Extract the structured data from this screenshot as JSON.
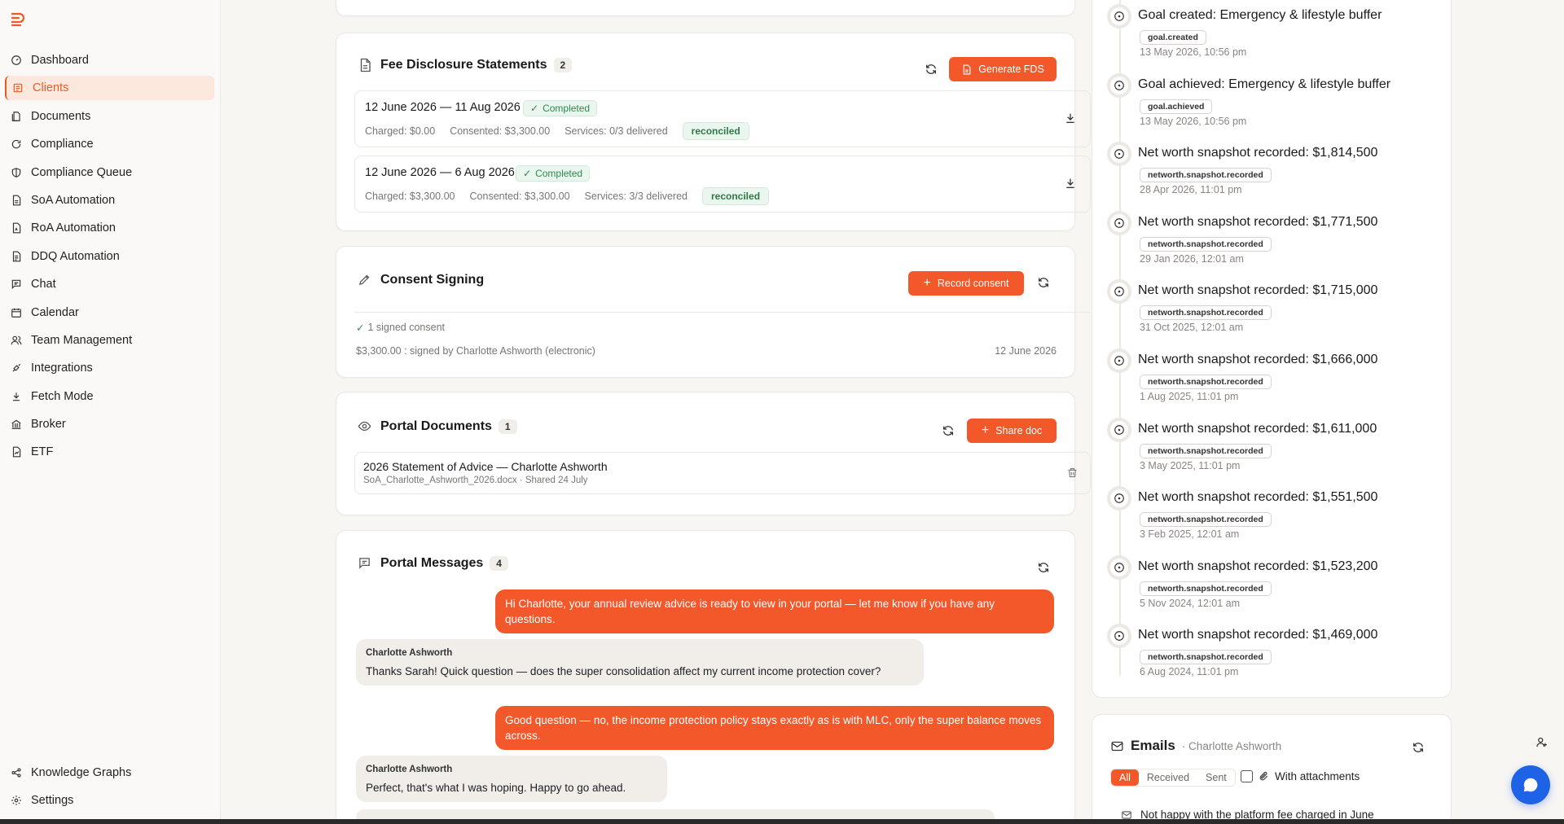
{
  "sidebar": {
    "items": [
      {
        "label": "Dashboard",
        "icon": "dashboard-icon"
      },
      {
        "label": "Clients",
        "icon": "clients-icon",
        "active": true
      },
      {
        "label": "Documents",
        "icon": "documents-icon"
      },
      {
        "label": "Compliance",
        "icon": "compliance-icon"
      },
      {
        "label": "Compliance Queue",
        "icon": "compliance-queue-icon"
      },
      {
        "label": "SoA Automation",
        "icon": "soa-automation-icon"
      },
      {
        "label": "RoA Automation",
        "icon": "roa-automation-icon"
      },
      {
        "label": "DDQ Automation",
        "icon": "ddq-automation-icon"
      },
      {
        "label": "Chat",
        "icon": "chat-icon"
      },
      {
        "label": "Calendar",
        "icon": "calendar-icon"
      },
      {
        "label": "Team Management",
        "icon": "team-icon"
      },
      {
        "label": "Integrations",
        "icon": "integrations-icon"
      },
      {
        "label": "Fetch Mode",
        "icon": "fetch-icon"
      },
      {
        "label": "Broker",
        "icon": "broker-icon"
      },
      {
        "label": "ETF",
        "icon": "etf-icon"
      }
    ],
    "bottom": [
      {
        "label": "Knowledge Graphs",
        "icon": "knowledge-graph-icon"
      },
      {
        "label": "Settings",
        "icon": "settings-icon"
      }
    ]
  },
  "fds": {
    "title": "Fee Disclosure Statements",
    "count": "2",
    "generate_label": "Generate FDS",
    "rows": [
      {
        "period": "12 June 2026 — 11 Aug 2026",
        "status": "Completed",
        "charged": "Charged: $0.00",
        "consented": "Consented: $3,300.00",
        "services": "Services: 0/3 delivered",
        "tag": "reconciled"
      },
      {
        "period": "12 June 2026 — 6 Aug 2026",
        "status": "Completed",
        "charged": "Charged: $3,300.00",
        "consented": "Consented: $3,300.00",
        "services": "Services: 3/3 delivered",
        "tag": "reconciled"
      }
    ]
  },
  "consent": {
    "title": "Consent Signing",
    "record_label": "Record consent",
    "signed_count": "1 signed consent",
    "detail": "$3,300.00 : signed by Charlotte Ashworth (electronic)",
    "date": "12 June 2026"
  },
  "portal_docs": {
    "title": "Portal Documents",
    "count": "1",
    "share_label": "Share doc",
    "doc_title": "2026 Statement of Advice — Charlotte Ashworth",
    "doc_meta": "SoA_Charlotte_Ashworth_2026.docx · Shared 24 July"
  },
  "portal_messages": {
    "title": "Portal Messages",
    "count": "4",
    "messages": [
      {
        "dir": "out",
        "text": "Hi Charlotte, your annual review advice is ready to view in your portal — let me know if you have any questions."
      },
      {
        "dir": "in",
        "sender": "Charlotte Ashworth",
        "text": "Thanks Sarah! Quick question — does the super consolidation affect my current income protection cover?"
      },
      {
        "dir": "out",
        "text": "Good question — no, the income protection policy stays exactly as is with MLC, only the super balance moves across."
      },
      {
        "dir": "in",
        "sender": "Charlotte Ashworth",
        "text": "Perfect, that's what I was hoping. Happy to go ahead."
      }
    ]
  },
  "timeline": [
    {
      "title": "Goal created: Emergency & lifestyle buffer",
      "tag": "goal.created",
      "time": "13 May 2026, 10:56 pm"
    },
    {
      "title": "Goal achieved: Emergency & lifestyle buffer",
      "tag": "goal.achieved",
      "time": "13 May 2026, 10:56 pm"
    },
    {
      "title": "Net worth snapshot recorded: $1,814,500",
      "tag": "networth.snapshot.recorded",
      "time": "28 Apr 2026, 11:01 pm"
    },
    {
      "title": "Net worth snapshot recorded: $1,771,500",
      "tag": "networth.snapshot.recorded",
      "time": "29 Jan 2026, 12:01 am"
    },
    {
      "title": "Net worth snapshot recorded: $1,715,000",
      "tag": "networth.snapshot.recorded",
      "time": "31 Oct 2025, 12:01 am"
    },
    {
      "title": "Net worth snapshot recorded: $1,666,000",
      "tag": "networth.snapshot.recorded",
      "time": "1 Aug 2025, 11:01 pm"
    },
    {
      "title": "Net worth snapshot recorded: $1,611,000",
      "tag": "networth.snapshot.recorded",
      "time": "3 May 2025, 11:01 pm"
    },
    {
      "title": "Net worth snapshot recorded: $1,551,500",
      "tag": "networth.snapshot.recorded",
      "time": "3 Feb 2025, 12:01 am"
    },
    {
      "title": "Net worth snapshot recorded: $1,523,200",
      "tag": "networth.snapshot.recorded",
      "time": "5 Nov 2024, 12:01 am"
    },
    {
      "title": "Net worth snapshot recorded: $1,469,000",
      "tag": "networth.snapshot.recorded",
      "time": "6 Aug 2024, 11:01 pm"
    }
  ],
  "emails": {
    "title": "Emails",
    "client": "· Charlotte Ashworth",
    "filters": [
      "All",
      "Received",
      "Sent"
    ],
    "attachments_label": "With attachments",
    "first_subject": "Not happy with the platform fee charged in June"
  },
  "colors": {
    "accent": "#f2582a",
    "success": "#2c8a4e",
    "fab": "#1e63e6"
  }
}
